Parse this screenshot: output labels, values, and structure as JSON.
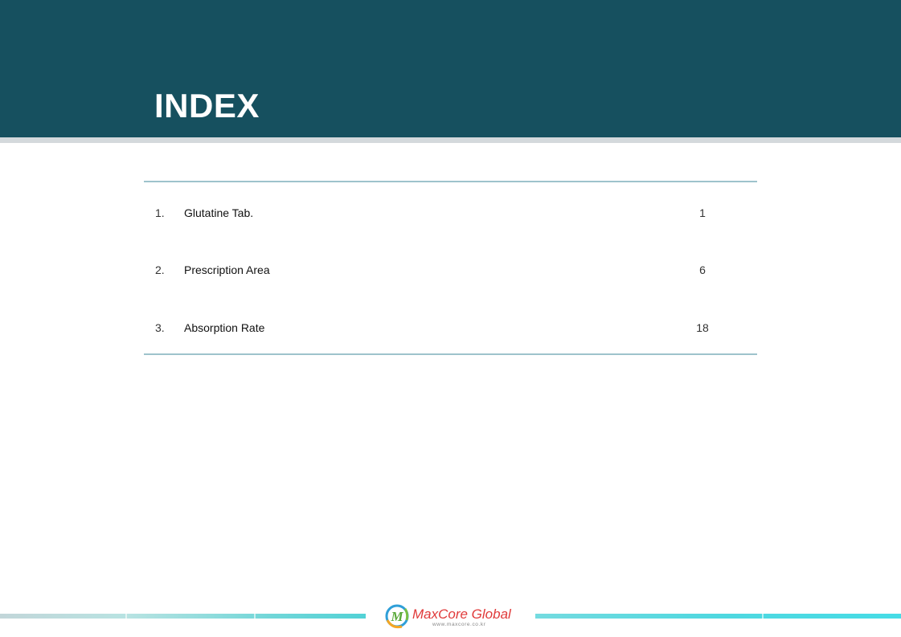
{
  "header": {
    "title": "INDEX"
  },
  "toc": {
    "entries": [
      {
        "number": "1.",
        "label": "Glutatine Tab.",
        "page": "1"
      },
      {
        "number": "2.",
        "label": "Prescription Area",
        "page": "6"
      },
      {
        "number": "3.",
        "label": "Absorption Rate",
        "page": "18"
      }
    ]
  },
  "footer": {
    "logo_name": "MaxCore Global",
    "logo_url": "www.maxcore.co.kr",
    "logo_monogram": "M"
  },
  "colors": {
    "header_band": "#16505f",
    "rule_line": "#9ec3cc",
    "logo_text": "#e03a3a",
    "footer_accent": "#4fd8e0"
  },
  "icons": {
    "logo": "maxcore-logo-icon"
  }
}
